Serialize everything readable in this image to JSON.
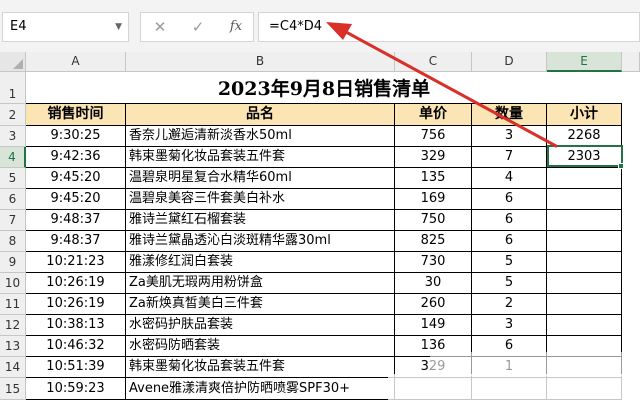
{
  "formula_bar": {
    "name_box": "E4",
    "cancel_icon": "✕",
    "enter_icon": "✓",
    "fx_label": "fx",
    "formula": "=C4*D4"
  },
  "columns": [
    "A",
    "B",
    "C",
    "D",
    "E"
  ],
  "rows": [
    "1",
    "2",
    "3",
    "4",
    "5",
    "6",
    "7",
    "8",
    "9",
    "10",
    "11",
    "12",
    "13",
    "14",
    "15"
  ],
  "sheet": {
    "title": "2023年9月8日销售清单",
    "headers": [
      "销售时间",
      "品名",
      "单价",
      "数量",
      "小计"
    ],
    "records": [
      {
        "time": "9:30:25",
        "name": "香奈儿邂逅清新淡香水50ml",
        "price": "756",
        "qty": "3",
        "subtotal": "2268"
      },
      {
        "time": "9:42:36",
        "name": "韩束墨菊化妆品套装五件套",
        "price": "329",
        "qty": "7",
        "subtotal": "2303"
      },
      {
        "time": "9:45:20",
        "name": "温碧泉明星复合水精华60ml",
        "price": "135",
        "qty": "4",
        "subtotal": ""
      },
      {
        "time": "9:45:20",
        "name": "温碧泉美容三件套美白补水",
        "price": "169",
        "qty": "6",
        "subtotal": ""
      },
      {
        "time": "9:48:37",
        "name": "雅诗兰黛红石榴套装",
        "price": "750",
        "qty": "6",
        "subtotal": ""
      },
      {
        "time": "9:48:37",
        "name": "雅诗兰黛晶透沁白淡斑精华露30ml",
        "price": "825",
        "qty": "6",
        "subtotal": ""
      },
      {
        "time": "10:21:23",
        "name": "雅漾修红润白套装",
        "price": "730",
        "qty": "5",
        "subtotal": ""
      },
      {
        "time": "10:26:19",
        "name": "Za美肌无瑕两用粉饼盒",
        "price": "30",
        "qty": "5",
        "subtotal": ""
      },
      {
        "time": "10:26:19",
        "name": "Za新焕真皙美白三件套",
        "price": "260",
        "qty": "2",
        "subtotal": ""
      },
      {
        "time": "10:38:13",
        "name": "水密码护肤品套装",
        "price": "149",
        "qty": "3",
        "subtotal": ""
      },
      {
        "time": "10:46:32",
        "name": "水密码防晒套装",
        "price": "136",
        "qty": "6",
        "subtotal": ""
      },
      {
        "time": "10:51:39",
        "name": "韩束墨菊化妆品套装五件套",
        "price": "329",
        "qty": "1",
        "subtotal": ""
      },
      {
        "time": "10:59:23",
        "name": "Avene雅漾清爽倍护防晒喷雾SPF30+",
        "price": "",
        "qty": "",
        "subtotal": ""
      }
    ]
  },
  "colors": {
    "header_fill": "#fbe5b5",
    "selection": "#217346",
    "annotation_arrow": "#d9302a"
  }
}
